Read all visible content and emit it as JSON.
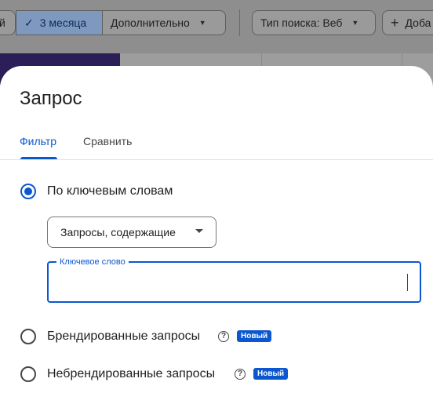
{
  "toolbar": {
    "chip_partial": "й",
    "chip_period": "3 месяца",
    "chip_more": "Дополнительно",
    "chip_search_type": "Тип поиска: Веб",
    "chip_add": "Доба"
  },
  "dialog": {
    "title": "Запрос",
    "tabs": [
      {
        "label": "Фильтр",
        "active": true
      },
      {
        "label": "Сравнить",
        "active": false
      }
    ],
    "options": [
      {
        "label": "По ключевым словам",
        "selected": true
      },
      {
        "label": "Брендированные запросы",
        "selected": false,
        "badge": "Новый"
      },
      {
        "label": "Небрендированные запросы",
        "selected": false,
        "badge": "Новый"
      }
    ],
    "match_dropdown": {
      "value": "Запросы, содержащие"
    },
    "keyword_field": {
      "label": "Ключевое слово",
      "value": ""
    },
    "help_glyph": "?"
  },
  "colors": {
    "accent": "#0b57d0",
    "scrim": "#8e8e8e",
    "surface": "#ffffff"
  }
}
